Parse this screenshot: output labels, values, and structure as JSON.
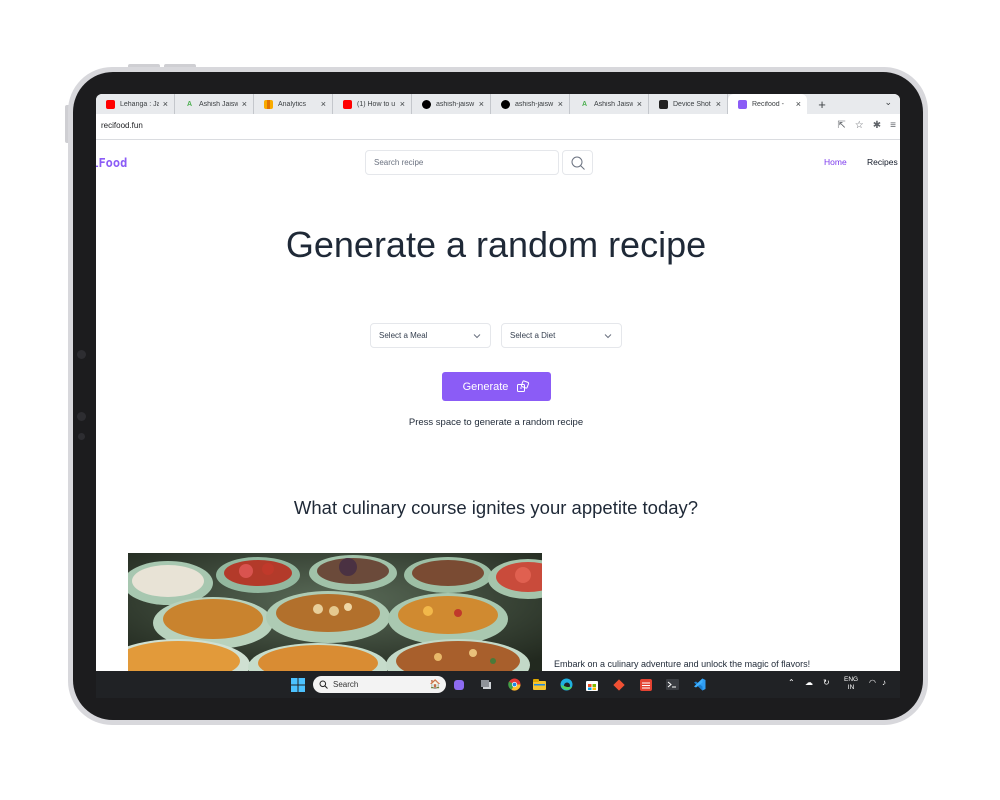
{
  "browser": {
    "tabs": [
      {
        "title": "Lehanga : Ja",
        "icon": "youtube-icon",
        "color": "#ff0000"
      },
      {
        "title": "Ashish Jaisw",
        "icon": "ashish-a-icon",
        "color": "#4caf50"
      },
      {
        "title": "Analytics",
        "icon": "analytics-icon",
        "color": "#f9ab00"
      },
      {
        "title": "(1) How to u",
        "icon": "youtube-icon",
        "color": "#ff0000"
      },
      {
        "title": "ashish-jaisw",
        "icon": "vercel-icon",
        "color": "#000000"
      },
      {
        "title": "ashish-jaisw",
        "icon": "vercel-icon",
        "color": "#000000"
      },
      {
        "title": "Ashish Jaisw",
        "icon": "ashish-a-icon",
        "color": "#4caf50"
      },
      {
        "title": "Device Shot",
        "icon": "device-shot-icon",
        "color": "#222222"
      },
      {
        "title": "Recifood - ",
        "icon": "recifood-icon",
        "color": "#8b5cf6",
        "active": true
      }
    ],
    "url": "recifood.fun"
  },
  "site": {
    "logo": "ciFood",
    "search_placeholder": "Search recipe",
    "nav": {
      "home": "Home",
      "recipes": "Recipes"
    },
    "hero_title": "Generate a random recipe",
    "select_meal": "Select a Meal",
    "select_diet": "Select a Diet",
    "generate_label": "Generate",
    "hint": "Press space to generate a random recipe",
    "section_title": "What culinary course ignites your appetite today?",
    "card_caption": "Embark on a culinary adventure and unlock the magic of flavors!"
  },
  "taskbar": {
    "search_label": "Search",
    "lang_line1": "ENG",
    "lang_line2": "IN"
  },
  "colors": {
    "accent": "#8b5cf6",
    "text": "#1f2937",
    "taskbar": "#202225"
  }
}
